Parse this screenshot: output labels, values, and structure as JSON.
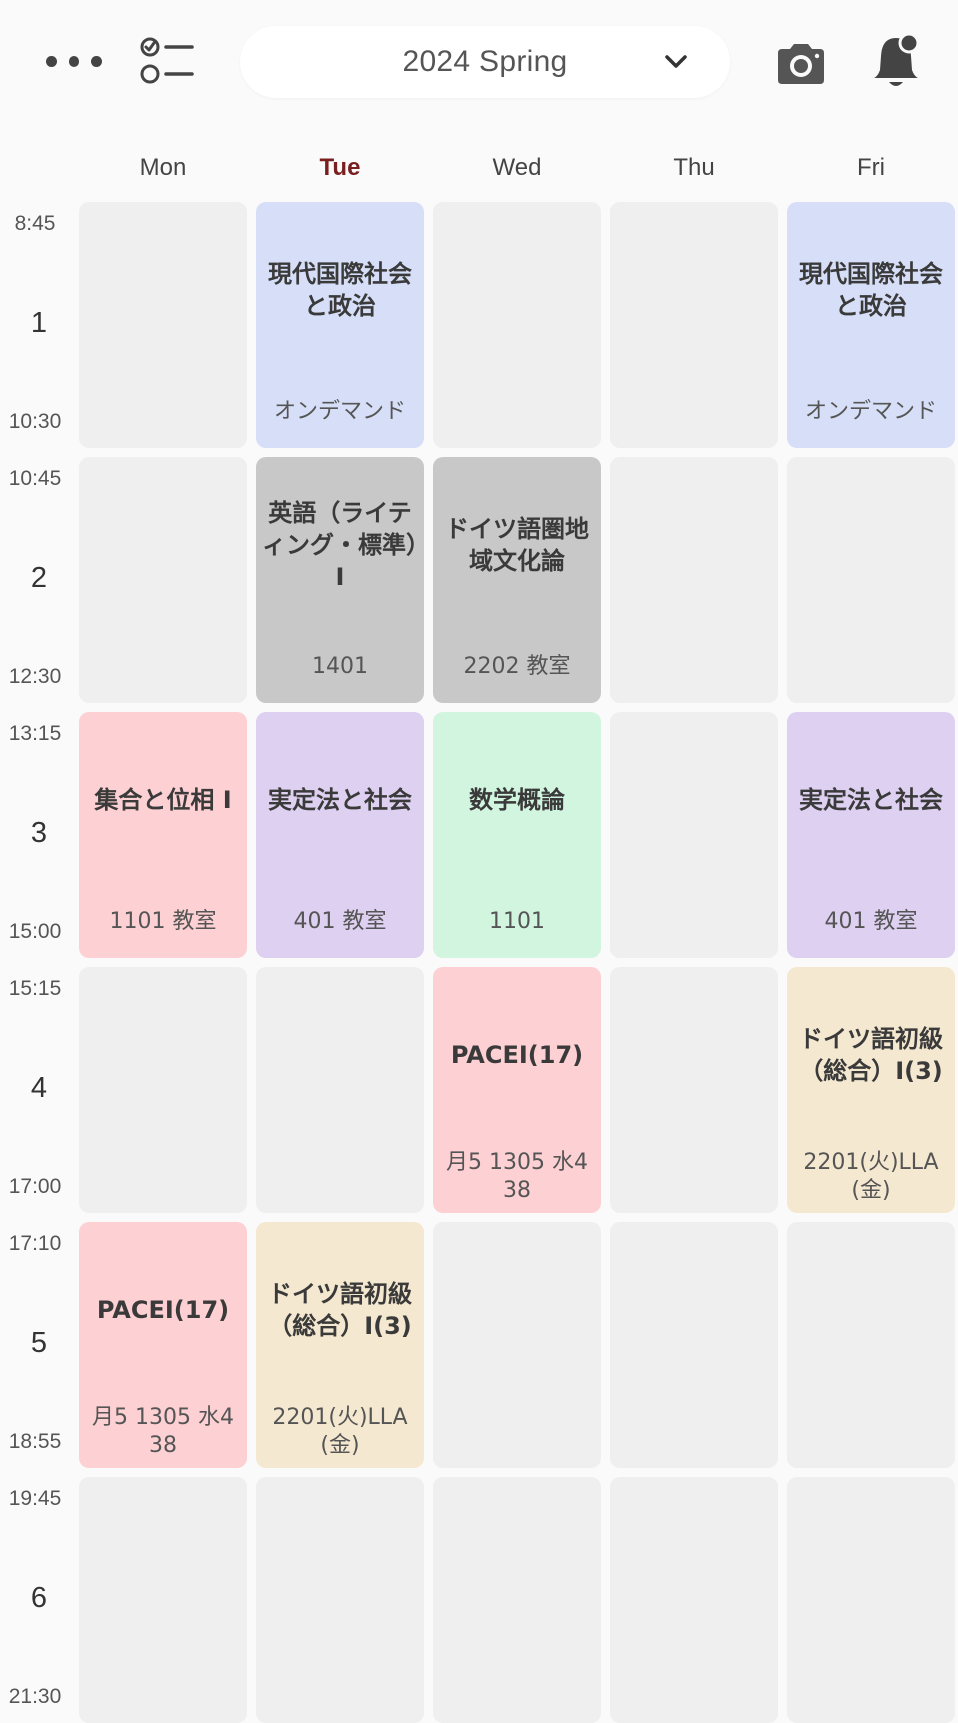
{
  "header": {
    "semester": "2024 Spring",
    "icons": {
      "more": "more-icon",
      "todo": "todo-list-icon",
      "dropdown": "chevron-down-icon",
      "camera": "camera-icon",
      "notifications": "bell-icon"
    }
  },
  "days": [
    {
      "label": "Mon",
      "today": false
    },
    {
      "label": "Tue",
      "today": true
    },
    {
      "label": "Wed",
      "today": false
    },
    {
      "label": "Thu",
      "today": false
    },
    {
      "label": "Fri",
      "today": false
    }
  ],
  "periods": [
    {
      "number": "1",
      "start": "8:45",
      "end": "10:30"
    },
    {
      "number": "2",
      "start": "10:45",
      "end": "12:30"
    },
    {
      "number": "3",
      "start": "13:15",
      "end": "15:00"
    },
    {
      "number": "4",
      "start": "15:15",
      "end": "17:00"
    },
    {
      "number": "5",
      "start": "17:10",
      "end": "18:55"
    },
    {
      "number": "6",
      "start": "19:45",
      "end": "21:30"
    }
  ],
  "colors": {
    "blue": "#d6dff7",
    "gray": "#c8c8c8",
    "pink": "#fdd0d3",
    "purple": "#ddd0f0",
    "green": "#d2f5e0",
    "beige": "#f5e8d0",
    "empty": "#efefef",
    "today_text": "#7a1f1f"
  },
  "courses": [
    {
      "day": 1,
      "period": 0,
      "title": "現代国際社会と政治",
      "room": "オンデマンド",
      "color": "blue"
    },
    {
      "day": 4,
      "period": 0,
      "title": "現代国際社会と政治",
      "room": "オンデマンド",
      "color": "blue"
    },
    {
      "day": 1,
      "period": 1,
      "title": "英語（ライティング・標準）I",
      "room": "1401",
      "color": "gray"
    },
    {
      "day": 2,
      "period": 1,
      "title": "ドイツ語圏地域文化論",
      "room": "2202 教室",
      "color": "gray"
    },
    {
      "day": 0,
      "period": 2,
      "title": "集合と位相 I",
      "room": "1101 教室",
      "color": "pink"
    },
    {
      "day": 1,
      "period": 2,
      "title": "実定法と社会",
      "room": "401 教室",
      "color": "purple"
    },
    {
      "day": 2,
      "period": 2,
      "title": "数学概論",
      "room": "1101",
      "color": "green"
    },
    {
      "day": 4,
      "period": 2,
      "title": "実定法と社会",
      "room": "401 教室",
      "color": "purple"
    },
    {
      "day": 2,
      "period": 3,
      "title": "PACEI(17)",
      "room": "月5 1305 水4 38",
      "color": "pink"
    },
    {
      "day": 4,
      "period": 3,
      "title": "ドイツ語初級（総合）I(3)",
      "room": "2201(火)LLA(金)",
      "color": "beige"
    },
    {
      "day": 0,
      "period": 4,
      "title": "PACEI(17)",
      "room": "月5 1305 水4 38",
      "color": "pink"
    },
    {
      "day": 1,
      "period": 4,
      "title": "ドイツ語初級（総合）I(3)",
      "room": "2201(火)LLA(金)",
      "color": "beige"
    }
  ]
}
